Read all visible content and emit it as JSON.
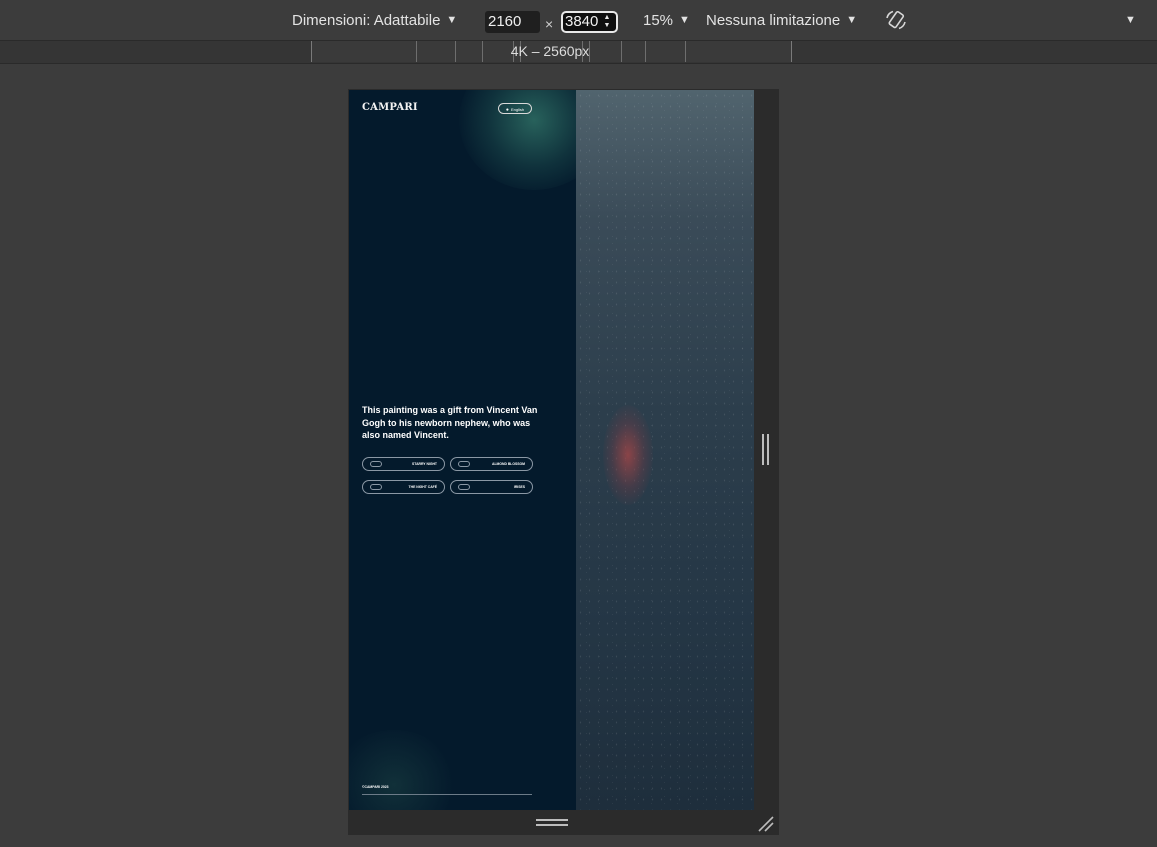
{
  "toolbar": {
    "dimensions_label": "Dimensioni: Adattabile",
    "width_value": "2160",
    "times_symbol": "×",
    "height_value": "3840",
    "zoom_label": "15%",
    "throttle_label": "Nessuna limitazione",
    "rotate_icon": "rotate-icon",
    "more_icon": "chevron-down-icon"
  },
  "ruler": {
    "active_label": "4K – 2560px"
  },
  "site": {
    "logo": "CAMPARI",
    "lang_label": "English",
    "headline": "This painting was a gift from Vincent Van Gogh to his newborn nephew, who was also named Vincent.",
    "chips": [
      "STARRY NIGHT",
      "ALMOND BLOSSOM",
      "THE NIGHT CAFÉ",
      "IRISES"
    ],
    "footer": "©CAMPARI 2023"
  },
  "colors": {
    "toolbar_bg": "#3c3c3c",
    "site_dark": "#041a2c",
    "accent_glow": "#2e6e64"
  }
}
